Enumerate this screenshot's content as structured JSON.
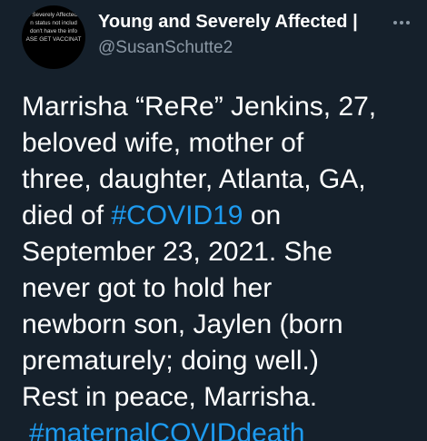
{
  "author": {
    "display_name": "Young and Severely Affected |",
    "handle": "@SusanSchutte2",
    "avatar_text": [
      "n Severely Affected i",
      "n status not includ",
      "don't have the info",
      "ASE GET VACCINAT"
    ]
  },
  "more_icon": "more-horizontal-icon",
  "tweet": {
    "line1": "Marrisha “ReRe” Jenkins, 27,",
    "line2": "beloved wife, mother of",
    "line3": "three, daughter, Atlanta, GA,",
    "line4_before": "died of ",
    "hashtag1": "#COVID19",
    "line4_after": " on",
    "line5": "September 23, 2021. She",
    "line6": "never got to hold her",
    "line7": "newborn son, Jaylen (born",
    "line8": "prematurely; doing well.)",
    "line9": "Rest in peace, Marrisha.",
    "hashtag2": "#maternalCOVIDdeath"
  },
  "colors": {
    "background": "#15202b",
    "text": "#ffffff",
    "secondary": "#8b98a5",
    "link": "#1d9bf0"
  }
}
